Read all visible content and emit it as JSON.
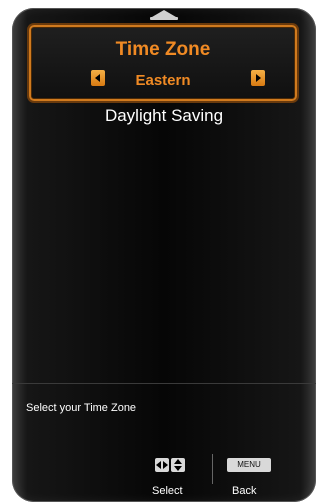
{
  "menu": {
    "selected_title": "Time Zone",
    "selected_value": "Eastern",
    "items": [
      "Daylight Saving"
    ]
  },
  "help": {
    "text": "Select your Time Zone"
  },
  "footer": {
    "select_label": "Select",
    "menu_key_label": "MENU",
    "back_label": "Back"
  },
  "colors": {
    "accent": "#f08a24",
    "border": "#d07a1e"
  }
}
